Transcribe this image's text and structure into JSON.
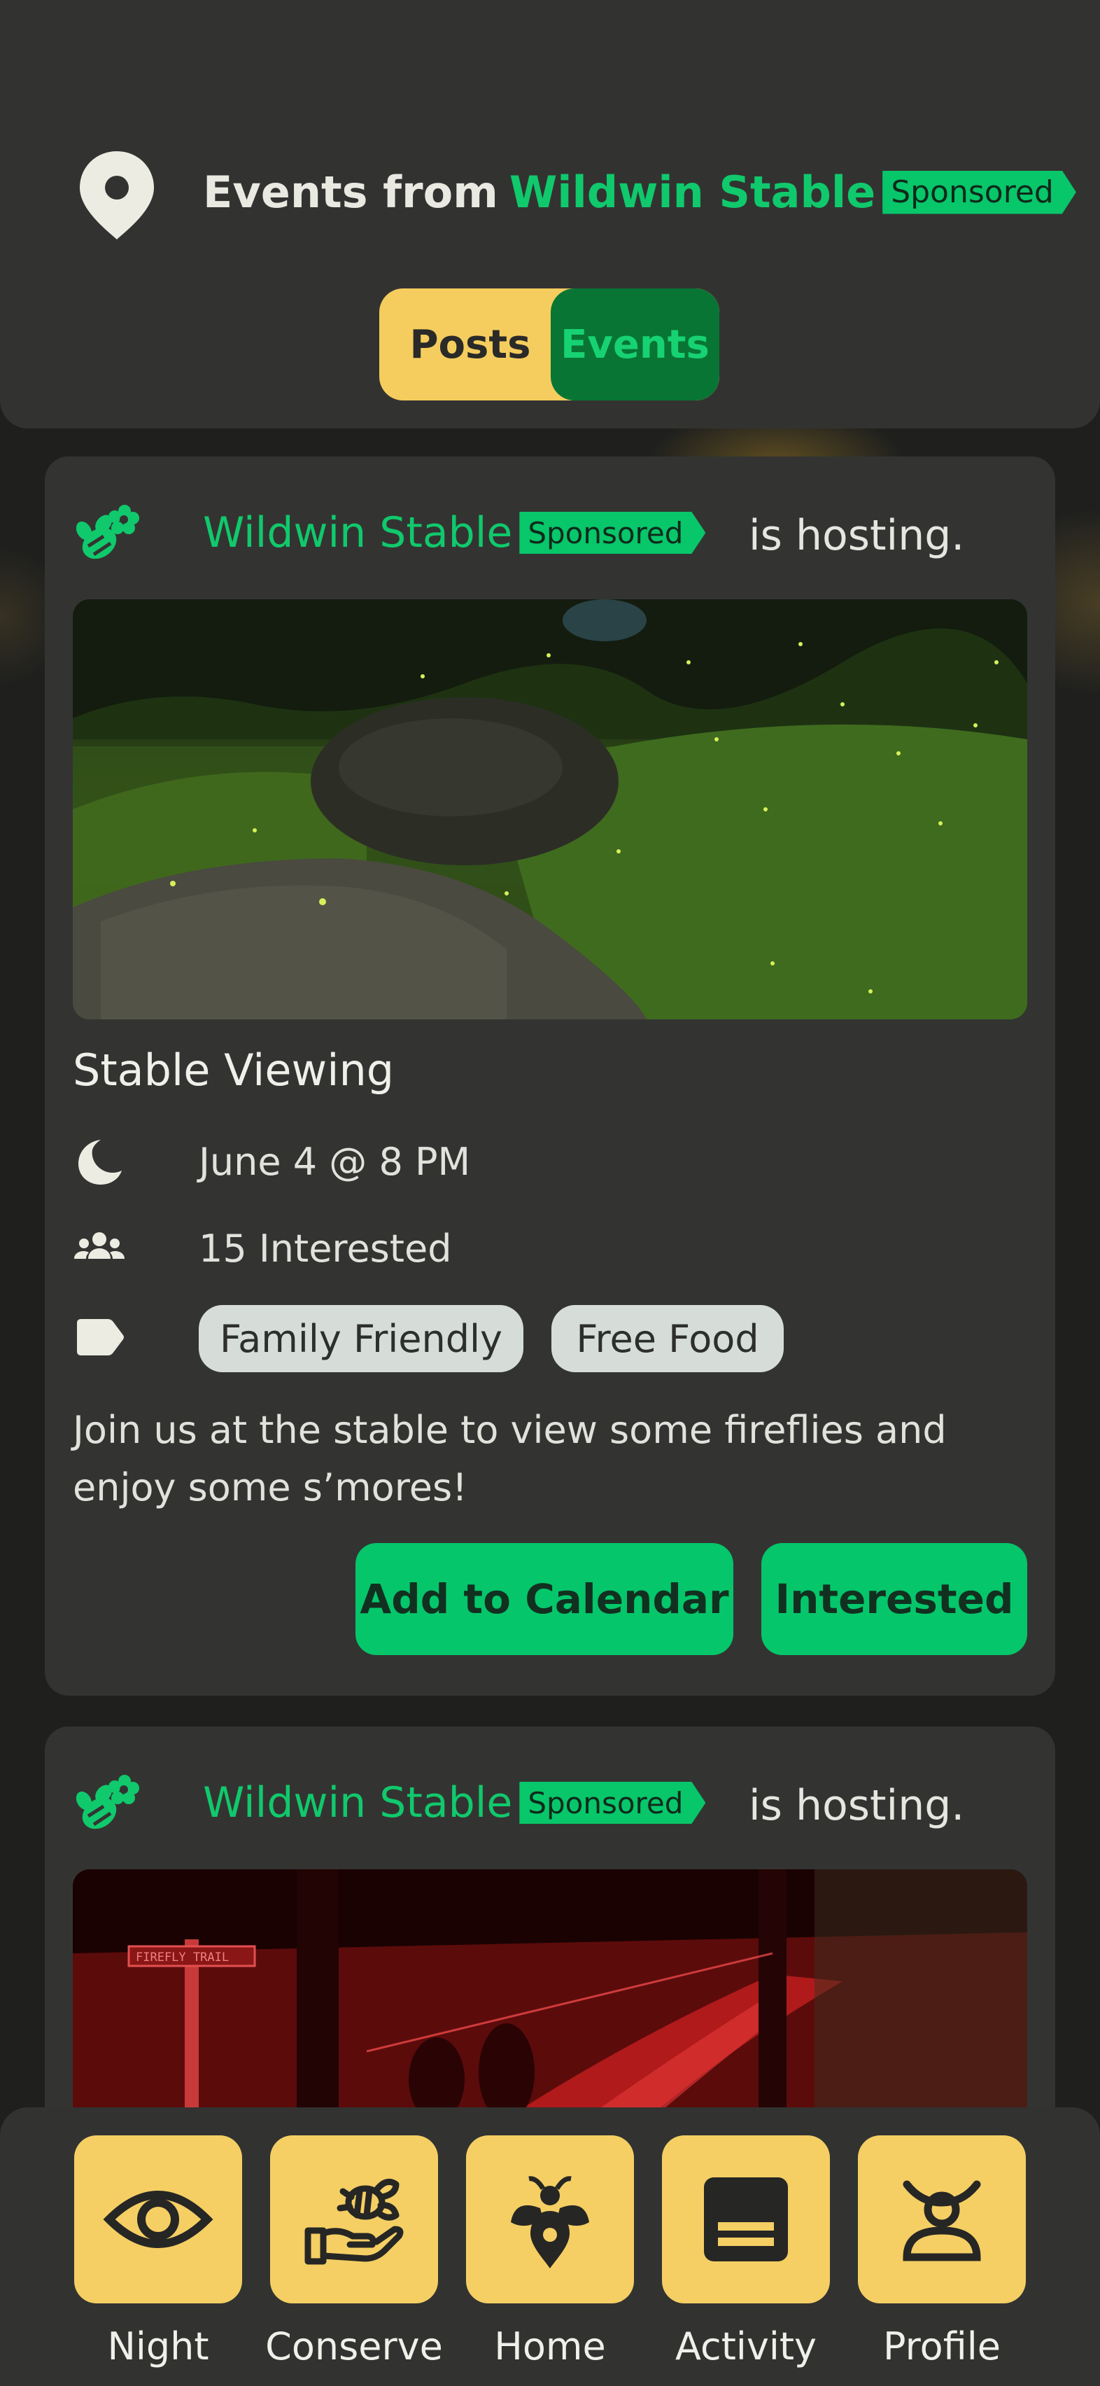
{
  "header": {
    "title_prefix": "Events from",
    "title_brand": "Wildwin Stable",
    "badge": "Sponsored",
    "icon": "location-pin-icon"
  },
  "toggle": {
    "posts_label": "Posts",
    "events_label": "Events",
    "active": "Events"
  },
  "events": [
    {
      "host": "Wildwin Stable",
      "badge": "Sponsored",
      "hosting_text": "is hosting.",
      "title": "Stable Viewing",
      "date": "June 4 @ 8 PM",
      "interested_count": "15 Interested",
      "tags": [
        "Family Friendly",
        "Free Food"
      ],
      "description": "Join us at the stable to view some fireflies and enjoy some s’mores!",
      "add_to_calendar_label": "Add to Calendar",
      "interested_label": "Interested"
    },
    {
      "host": "Wildwin Stable",
      "badge": "Sponsored",
      "hosting_text": "is hosting.",
      "image_sign_text": "FIREFLY TRAIL"
    }
  ],
  "nav": {
    "items": [
      {
        "label": "Night",
        "icon": "eye-icon"
      },
      {
        "label": "Conserve",
        "icon": "hand-bee-icon"
      },
      {
        "label": "Home",
        "icon": "firefly-pin-icon"
      },
      {
        "label": "Activity",
        "icon": "list-icon"
      },
      {
        "label": "Profile",
        "icon": "profile-icon"
      }
    ]
  },
  "colors": {
    "accent_green": "#10c96c",
    "button_green": "#05c66b",
    "dark_green": "#087535",
    "yellow": "#f5cd5e",
    "card_bg": "#333432",
    "page_bg": "#1f201e"
  }
}
